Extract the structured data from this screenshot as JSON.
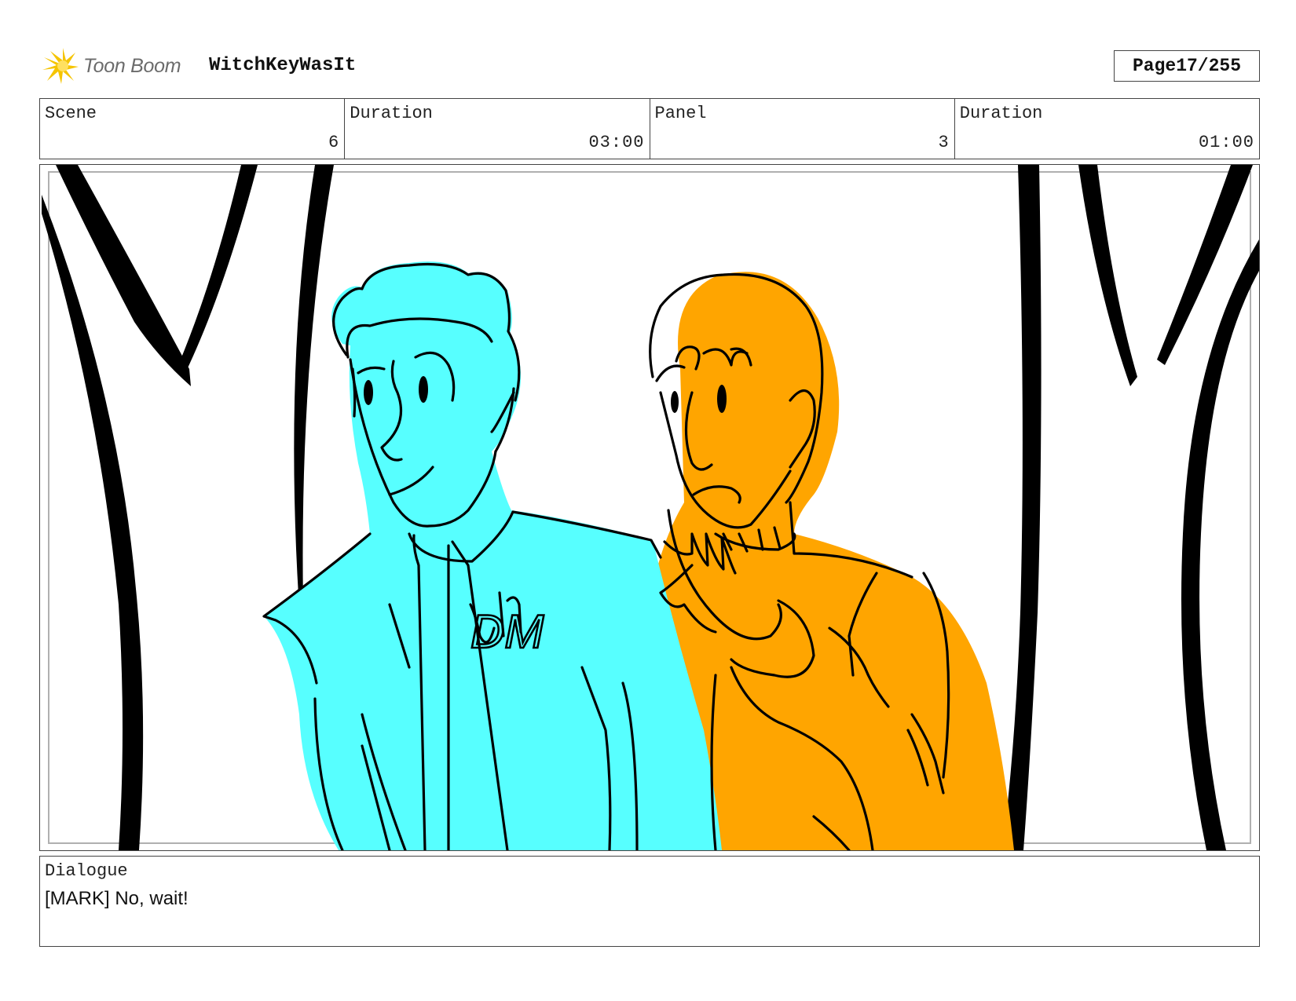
{
  "header": {
    "logo_text": "Toon Boom",
    "project_title": "WitchKeyWasIt",
    "page_label": "Page",
    "page_number": "17/255"
  },
  "info": {
    "scene_label": "Scene",
    "scene_value": "6",
    "scene_duration_label": "Duration",
    "scene_duration_value": "03:00",
    "panel_label": "Panel",
    "panel_value": "3",
    "panel_duration_label": "Duration",
    "panel_duration_value": "01:00"
  },
  "panel": {
    "left_character_color": "#57FFFF",
    "right_character_color": "#FFA500",
    "line_color": "#000000",
    "shirt_initials": "DM"
  },
  "dialogue": {
    "label": "Dialogue",
    "text": "[MARK] No, wait!"
  }
}
